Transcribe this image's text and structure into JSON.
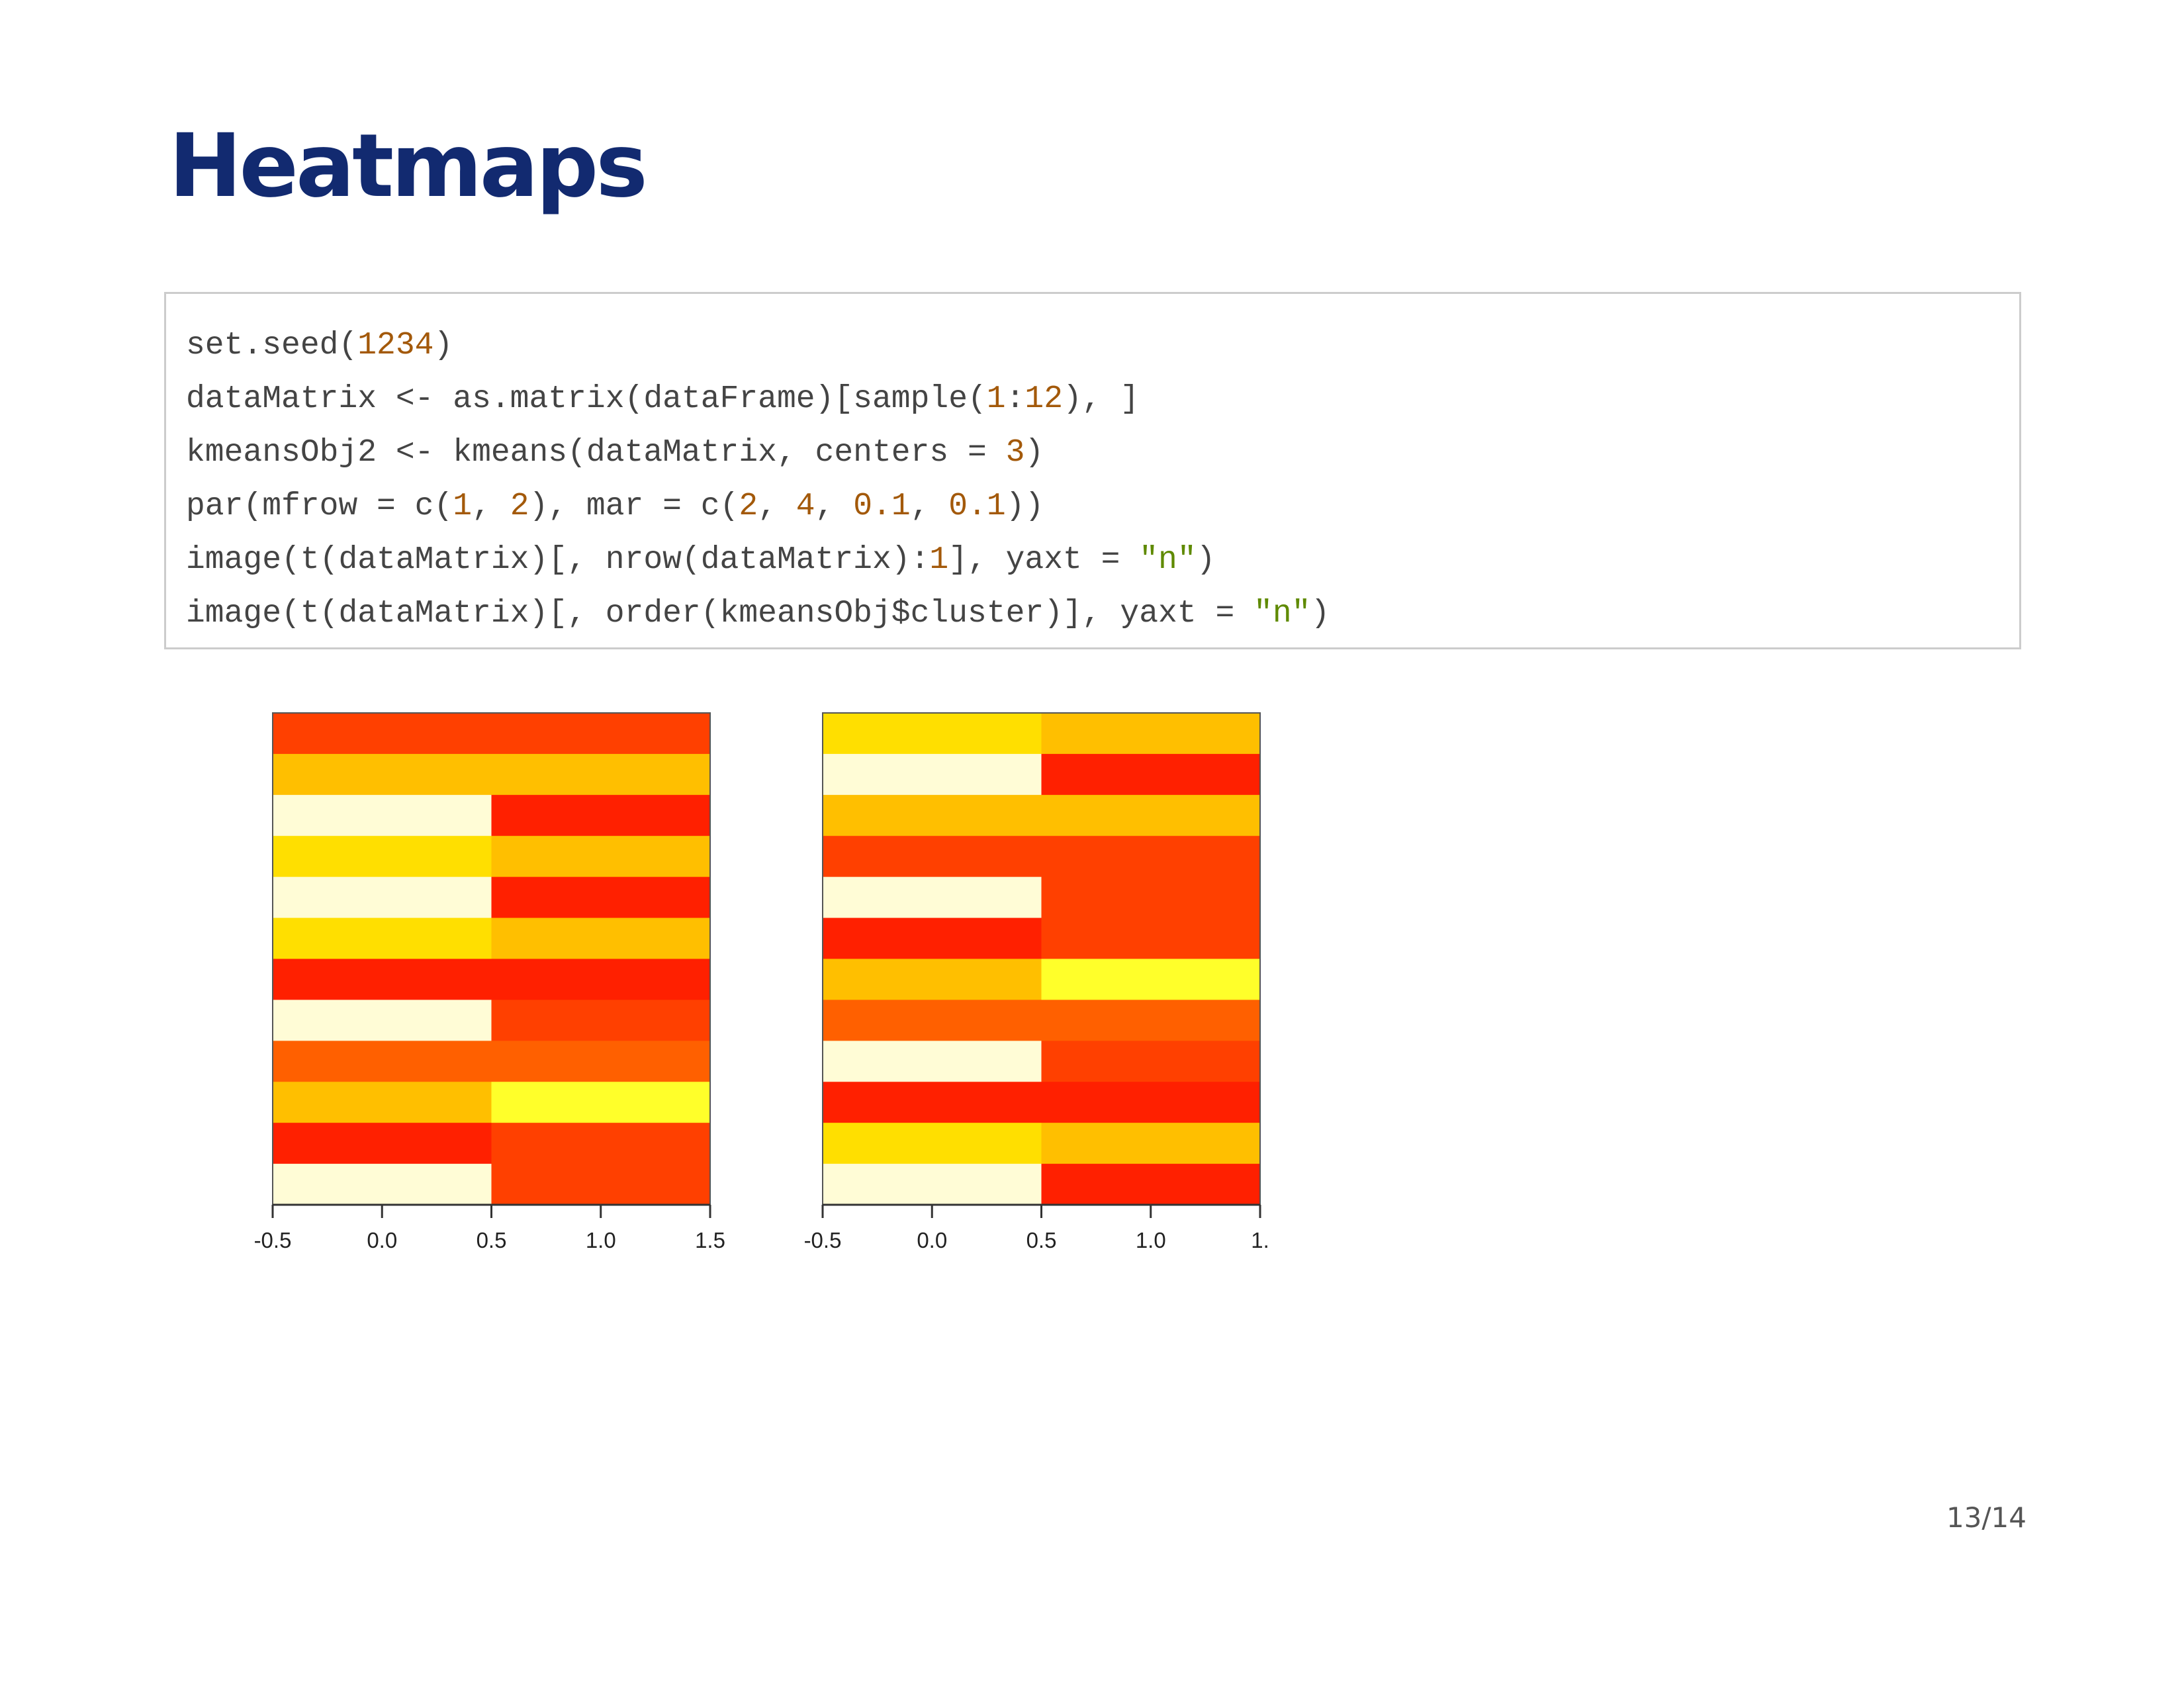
{
  "slide": {
    "title": "Heatmaps",
    "page_number": "13/14"
  },
  "code": {
    "lines": [
      [
        {
          "t": "set.seed(",
          "k": "plain"
        },
        {
          "t": "1234",
          "k": "num"
        },
        {
          "t": ")",
          "k": "plain"
        }
      ],
      [
        {
          "t": "dataMatrix <- as.matrix(dataFrame)[sample(",
          "k": "plain"
        },
        {
          "t": "1",
          "k": "num"
        },
        {
          "t": ":",
          "k": "plain"
        },
        {
          "t": "12",
          "k": "num"
        },
        {
          "t": "), ]",
          "k": "plain"
        }
      ],
      [
        {
          "t": "kmeansObj2 <- kmeans(dataMatrix, centers = ",
          "k": "plain"
        },
        {
          "t": "3",
          "k": "num"
        },
        {
          "t": ")",
          "k": "plain"
        }
      ],
      [
        {
          "t": "par(mfrow = c(",
          "k": "plain"
        },
        {
          "t": "1",
          "k": "num"
        },
        {
          "t": ", ",
          "k": "plain"
        },
        {
          "t": "2",
          "k": "num"
        },
        {
          "t": "), mar = c(",
          "k": "plain"
        },
        {
          "t": "2",
          "k": "num"
        },
        {
          "t": ", ",
          "k": "plain"
        },
        {
          "t": "4",
          "k": "num"
        },
        {
          "t": ", ",
          "k": "plain"
        },
        {
          "t": "0.1",
          "k": "num"
        },
        {
          "t": ", ",
          "k": "plain"
        },
        {
          "t": "0.1",
          "k": "num"
        },
        {
          "t": "))",
          "k": "plain"
        }
      ],
      [
        {
          "t": "image(t(dataMatrix)[, nrow(dataMatrix):",
          "k": "plain"
        },
        {
          "t": "1",
          "k": "num"
        },
        {
          "t": "], yaxt = ",
          "k": "plain"
        },
        {
          "t": "\"n\"",
          "k": "str"
        },
        {
          "t": ")",
          "k": "plain"
        }
      ],
      [
        {
          "t": "image(t(dataMatrix)[, order(kmeansObj$cluster)], yaxt = ",
          "k": "plain"
        },
        {
          "t": "\"n\"",
          "k": "str"
        },
        {
          "t": ")",
          "k": "plain"
        }
      ]
    ],
    "colors": {
      "plain": "#444444",
      "num": "#a3590a",
      "str": "#5f8a00"
    }
  },
  "chart_data": [
    {
      "type": "heatmap",
      "x_centers": [
        0,
        1
      ],
      "xlim": [
        -0.5,
        1.5
      ],
      "x_ticks": [
        "-0.5",
        "0.0",
        "0.5",
        "1.0",
        "1.5"
      ],
      "rows_top_to_bottom": [
        [
          "#ff4000",
          "#ff4000"
        ],
        [
          "#ffbf00",
          "#ffbf00"
        ],
        [
          "#fffcd6",
          "#ff2000"
        ],
        [
          "#ffdf00",
          "#ffbf00"
        ],
        [
          "#fffcd6",
          "#ff2000"
        ],
        [
          "#ffdf00",
          "#ffbf00"
        ],
        [
          "#ff2000",
          "#ff2000"
        ],
        [
          "#fffcd6",
          "#ff4000"
        ],
        [
          "#ff6000",
          "#ff6000"
        ],
        [
          "#ffbf00",
          "#ffff2a"
        ],
        [
          "#ff2000",
          "#ff4000"
        ],
        [
          "#fffcd6",
          "#ff4000"
        ]
      ]
    },
    {
      "type": "heatmap",
      "x_centers": [
        0,
        1
      ],
      "xlim": [
        -0.5,
        1.5
      ],
      "x_ticks": [
        "-0.5",
        "0.0",
        "0.5",
        "1.0",
        "1."
      ],
      "rows_top_to_bottom": [
        [
          "#ffdf00",
          "#ffbf00"
        ],
        [
          "#fffcd6",
          "#ff2000"
        ],
        [
          "#ffbf00",
          "#ffbf00"
        ],
        [
          "#ff4000",
          "#ff4000"
        ],
        [
          "#fffcd6",
          "#ff4000"
        ],
        [
          "#ff2000",
          "#ff4000"
        ],
        [
          "#ffbf00",
          "#ffff2a"
        ],
        [
          "#ff6000",
          "#ff6000"
        ],
        [
          "#fffcd6",
          "#ff4000"
        ],
        [
          "#ff2000",
          "#ff2000"
        ],
        [
          "#ffdf00",
          "#ffbf00"
        ],
        [
          "#fffcd6",
          "#ff2000"
        ]
      ]
    }
  ]
}
